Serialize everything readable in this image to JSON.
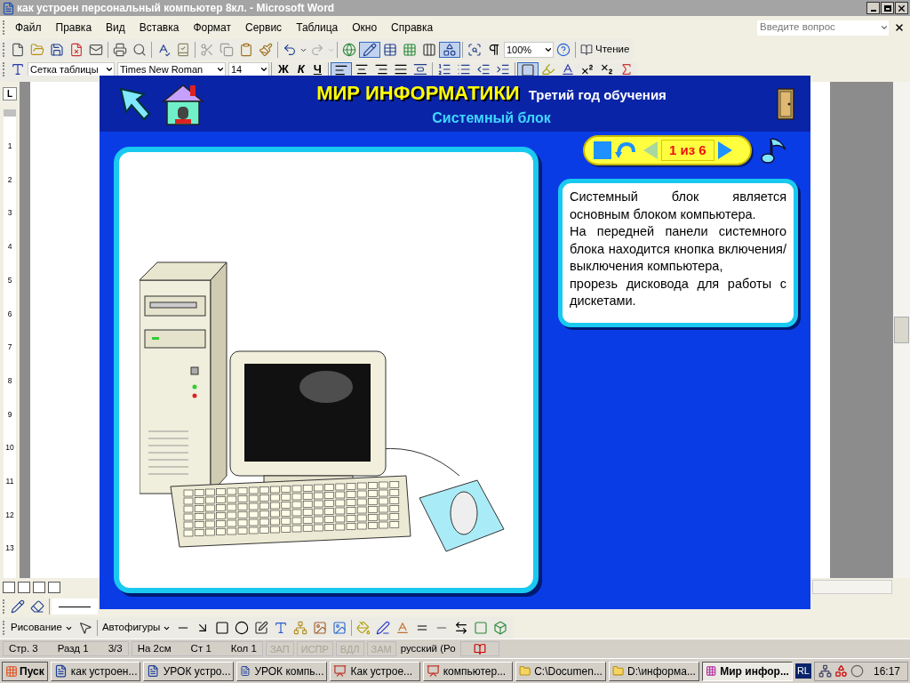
{
  "word": {
    "title": "как устроен персональный компьютер 8кл. - Microsoft Word",
    "menu": [
      "Файл",
      "Правка",
      "Вид",
      "Вставка",
      "Формат",
      "Сервис",
      "Таблица",
      "Окно",
      "Справка"
    ],
    "help_placeholder": "Введите вопрос",
    "zoom": "100%",
    "reading_button": "Чтение",
    "style": "Сетка таблицы",
    "font": "Times New Roman",
    "size": "14",
    "bold": "Ж",
    "italic": "К",
    "underline": "Ч",
    "ruler_tab": "L",
    "ruler_numbers": [
      "1",
      "2",
      "3",
      "4",
      "5",
      "6",
      "7",
      "8",
      "9",
      "10",
      "11",
      "12",
      "13"
    ],
    "drawing_menu": "Рисование",
    "autoshapes_menu": "Автофигуры"
  },
  "status_bar": {
    "groups": [
      [
        "Стр. 3",
        "Разд 1",
        "3/3"
      ],
      [
        "На 2см",
        "Ст 1",
        "Кол 1"
      ]
    ],
    "indicators": [
      {
        "text": "ЗАП",
        "disabled": true
      },
      {
        "text": "ИСПР",
        "disabled": true
      },
      {
        "text": "ВДЛ",
        "disabled": true
      },
      {
        "text": "ЗАМ",
        "disabled": true
      }
    ],
    "language": "русский (Ро"
  },
  "taskbar": {
    "start": "Пуск",
    "buttons": [
      {
        "label": "как устроен...",
        "kind": "word",
        "selected": false
      },
      {
        "label": "УРОК устро...",
        "kind": "word",
        "selected": false
      },
      {
        "label": "УРОК компь...",
        "kind": "word",
        "selected": false
      },
      {
        "label": "Как устрое...",
        "kind": "ppt",
        "selected": false
      },
      {
        "label": "компьютер...",
        "kind": "ppt",
        "selected": false
      },
      {
        "label": "C:\\Documen...",
        "kind": "folder",
        "selected": false
      },
      {
        "label": "D:\\информа...",
        "kind": "folder",
        "selected": false
      },
      {
        "label": "Мир инфор...",
        "kind": "app",
        "selected": true
      }
    ],
    "language": "RL",
    "clock": "16:17"
  },
  "app": {
    "title": "МИР ИНФОРМАТИКИ",
    "subtitle": "Третий год обучения",
    "topic": "Системный блок",
    "counter": "1 из 6",
    "prev_enabled": false,
    "next_enabled": true,
    "paragraphs": [
      "Системный блок является основным блоком компьютера.",
      "На передней панели системного блока находится кнопка включения/выключения компьютера,",
      "прорезь дисковода для работы с дискетами."
    ]
  }
}
